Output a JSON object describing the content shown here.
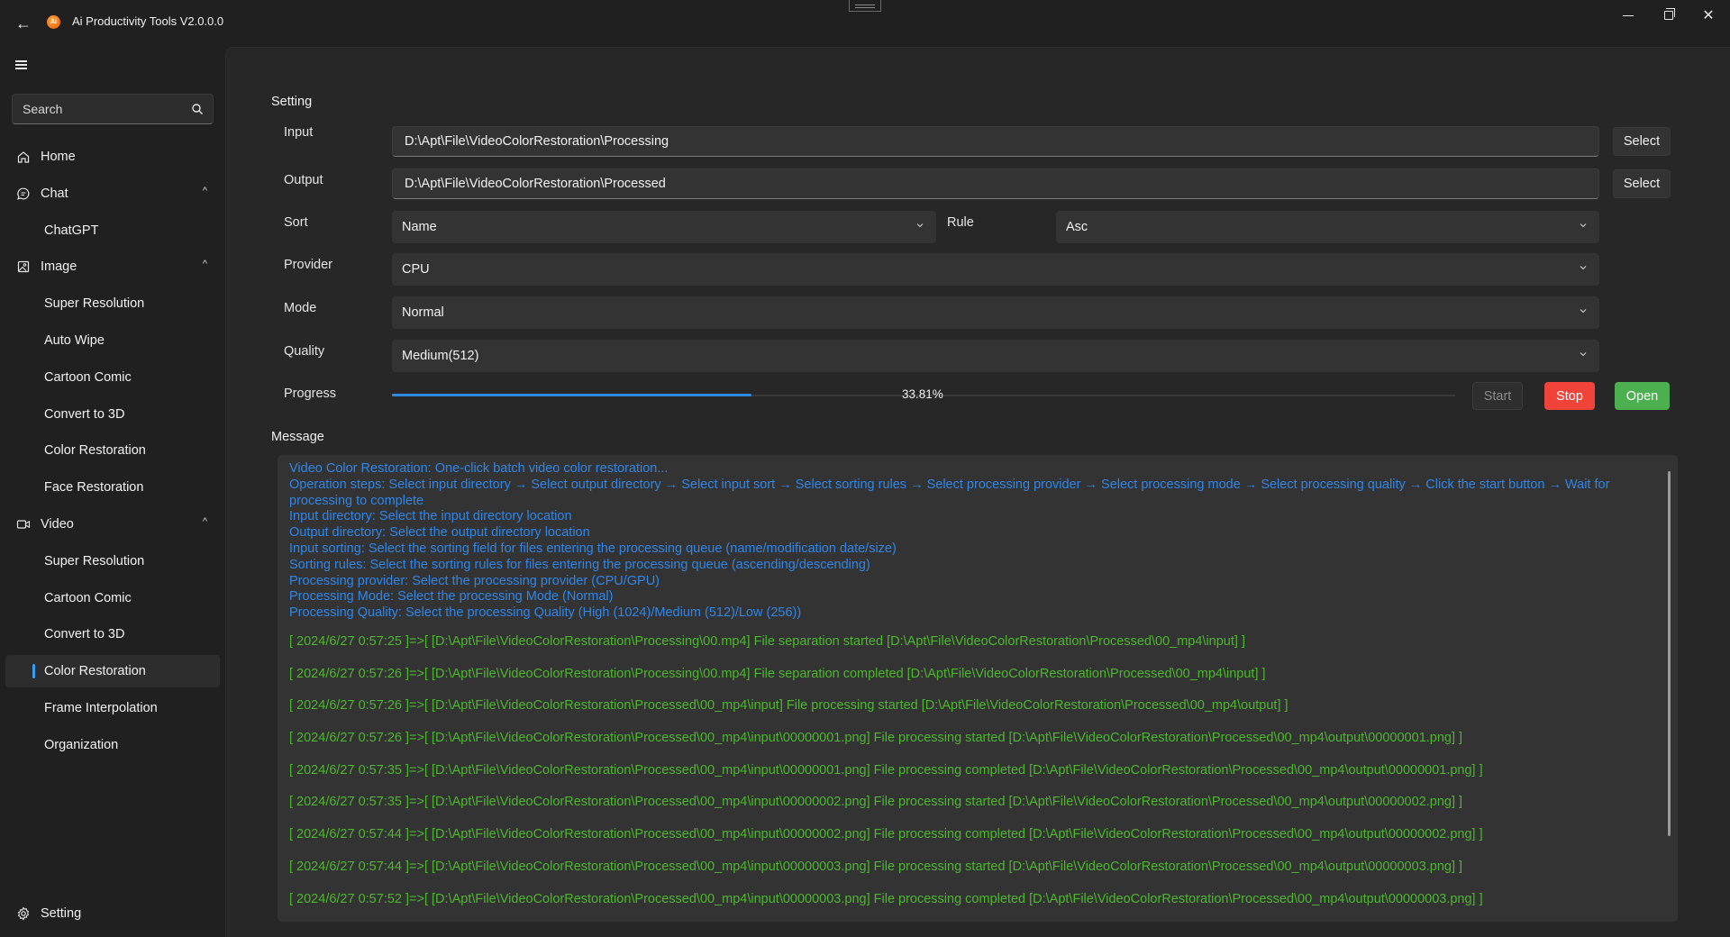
{
  "app": {
    "title": "Ai Productivity Tools V2.0.0.0",
    "logo_text": "Ai"
  },
  "titlebar": {
    "back_icon": "arrow-left-icon",
    "minimize_icon": "minimize-icon",
    "maximize_icon": "restore-icon",
    "close_icon": "close-icon",
    "close_glyph": "✕",
    "back_glyph": "←"
  },
  "sidebar": {
    "search_placeholder": "Search",
    "items": [
      {
        "label": "Home",
        "icon": "home-icon",
        "type": "top"
      },
      {
        "label": "Chat",
        "icon": "chat-icon",
        "type": "group",
        "expanded": true
      },
      {
        "label": "ChatGPT",
        "type": "sub"
      },
      {
        "label": "Image",
        "icon": "image-icon",
        "type": "group",
        "expanded": true
      },
      {
        "label": "Super Resolution",
        "type": "sub"
      },
      {
        "label": "Auto Wipe",
        "type": "sub"
      },
      {
        "label": "Cartoon Comic",
        "type": "sub"
      },
      {
        "label": "Convert to 3D",
        "type": "sub"
      },
      {
        "label": "Color Restoration",
        "type": "sub"
      },
      {
        "label": "Face Restoration",
        "type": "sub"
      },
      {
        "label": "Video",
        "icon": "video-icon",
        "type": "group",
        "expanded": true
      },
      {
        "label": "Super Resolution",
        "type": "sub"
      },
      {
        "label": "Cartoon Comic",
        "type": "sub"
      },
      {
        "label": "Convert to 3D",
        "type": "sub"
      },
      {
        "label": "Color Restoration",
        "type": "sub",
        "selected": true
      },
      {
        "label": "Frame Interpolation",
        "type": "sub"
      },
      {
        "label": "Organization",
        "type": "sub"
      }
    ],
    "footer": {
      "label": "Setting",
      "icon": "gear-icon"
    },
    "chevron_glyph": "^"
  },
  "setting": {
    "title": "Setting",
    "input": {
      "label": "Input",
      "value": "D:\\Apt\\File\\VideoColorRestoration\\Processing",
      "button": "Select"
    },
    "output": {
      "label": "Output",
      "value": "D:\\Apt\\File\\VideoColorRestoration\\Processed",
      "button": "Select"
    },
    "sort": {
      "label": "Sort",
      "value": "Name"
    },
    "rule": {
      "label": "Rule",
      "value": "Asc"
    },
    "provider": {
      "label": "Provider",
      "value": "CPU"
    },
    "mode": {
      "label": "Mode",
      "value": "Normal"
    },
    "quality": {
      "label": "Quality",
      "value": "Medium(512)"
    },
    "progress": {
      "label": "Progress",
      "value_percent": 33.81,
      "text": "33.81%"
    },
    "buttons": {
      "start": "Start",
      "stop": "Stop",
      "open": "Open"
    },
    "colors": {
      "accent": "#2c8ae0",
      "stop": "#f0433a",
      "open": "#4caf50",
      "info_text": "#2f86e8",
      "log_text": "#4cb82c"
    }
  },
  "message": {
    "title": "Message",
    "info_lines": [
      "Video Color Restoration: One-click batch video color restoration...",
      "Operation steps: Select input directory → Select output directory → Select input sort → Select sorting rules → Select processing provider → Select processing mode → Select processing quality → Click the start button → Wait for processing to complete",
      "Input directory: Select the input directory location",
      "Output directory: Select the output directory location",
      "Input sorting: Select the sorting field for files entering the processing queue (name/modification date/size)",
      "Sorting rules: Select the sorting rules for files entering the processing queue (ascending/descending)",
      "Processing provider: Select the processing provider (CPU/GPU)",
      "Processing Mode: Select the processing Mode (Normal)",
      "Processing Quality: Select the processing Quality (High (1024)/Medium (512)/Low (256))"
    ],
    "log_lines": [
      "[ 2024/6/27 0:57:25 ]=>[ [D:\\Apt\\File\\VideoColorRestoration\\Processing\\00.mp4] File separation started [D:\\Apt\\File\\VideoColorRestoration\\Processed\\00_mp4\\input] ]",
      "[ 2024/6/27 0:57:26 ]=>[ [D:\\Apt\\File\\VideoColorRestoration\\Processing\\00.mp4] File separation completed [D:\\Apt\\File\\VideoColorRestoration\\Processed\\00_mp4\\input] ]",
      "[ 2024/6/27 0:57:26 ]=>[ [D:\\Apt\\File\\VideoColorRestoration\\Processed\\00_mp4\\input] File processing started [D:\\Apt\\File\\VideoColorRestoration\\Processed\\00_mp4\\output] ]",
      "[ 2024/6/27 0:57:26 ]=>[ [D:\\Apt\\File\\VideoColorRestoration\\Processed\\00_mp4\\input\\00000001.png] File processing started [D:\\Apt\\File\\VideoColorRestoration\\Processed\\00_mp4\\output\\00000001.png] ]",
      "[ 2024/6/27 0:57:35 ]=>[ [D:\\Apt\\File\\VideoColorRestoration\\Processed\\00_mp4\\input\\00000001.png] File processing completed [D:\\Apt\\File\\VideoColorRestoration\\Processed\\00_mp4\\output\\00000001.png] ]",
      "[ 2024/6/27 0:57:35 ]=>[ [D:\\Apt\\File\\VideoColorRestoration\\Processed\\00_mp4\\input\\00000002.png] File processing started [D:\\Apt\\File\\VideoColorRestoration\\Processed\\00_mp4\\output\\00000002.png] ]",
      "[ 2024/6/27 0:57:44 ]=>[ [D:\\Apt\\File\\VideoColorRestoration\\Processed\\00_mp4\\input\\00000002.png] File processing completed [D:\\Apt\\File\\VideoColorRestoration\\Processed\\00_mp4\\output\\00000002.png] ]",
      "[ 2024/6/27 0:57:44 ]=>[ [D:\\Apt\\File\\VideoColorRestoration\\Processed\\00_mp4\\input\\00000003.png] File processing started [D:\\Apt\\File\\VideoColorRestoration\\Processed\\00_mp4\\output\\00000003.png] ]",
      "[ 2024/6/27 0:57:52 ]=>[ [D:\\Apt\\File\\VideoColorRestoration\\Processed\\00_mp4\\input\\00000003.png] File processing completed [D:\\Apt\\File\\VideoColorRestoration\\Processed\\00_mp4\\output\\00000003.png] ]"
    ]
  }
}
